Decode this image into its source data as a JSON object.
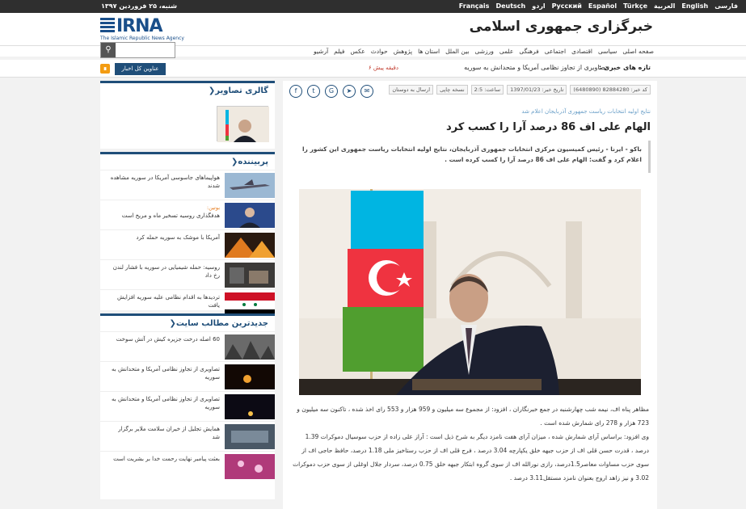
{
  "topbar": {
    "date": "شنبه، ۲۵ فروردین ۱۳۹۷",
    "languages": [
      "فارسی",
      "English",
      "العربية",
      "Türkçe",
      "Español",
      "Русский",
      "اردو",
      "Deutsch",
      "Français"
    ]
  },
  "header": {
    "logo_word": "IRNA",
    "logo_tag": "The Islamic Republic News Agency",
    "site_title": "خبرگزاری جمهوری اسلامی"
  },
  "nav": [
    "صفحه اصلی",
    "سیاسی",
    "اقتصادی",
    "اجتماعی",
    "فرهنگی",
    "علمی",
    "ورزشی",
    "بین الملل",
    "استان ها",
    "پژوهش",
    "حوادث",
    "عکس",
    "فیلم",
    "آرشیو"
  ],
  "search": {
    "placeholder": "",
    "icon": "search-icon"
  },
  "ticker": {
    "label": "تازه های خبری :",
    "headline": "تصاویری از تجاوز نظامی آمریکا و متحدانش به سوریه",
    "ago": "۶ دقیقه پیش"
  },
  "all_news_button": "عناوین کل اخبار",
  "sidebar": {
    "gallery_title": "گالری تصاویر",
    "popular_title": "پربیننده",
    "popular": [
      {
        "text": "هواپیماهای جاسوسی آمریکا در سوریه مشاهده شدند",
        "tag": ""
      },
      {
        "text": "هدفگذاری روسیه تسخیر ماه و مریخ است",
        "tag": "بوتین:"
      },
      {
        "text": "آمریکا با موشک به سوریه حمله کرد",
        "tag": ""
      },
      {
        "text": "روسیه: حمله شیمیایی در سوریه با فشار لندن رخ داد",
        "tag": ""
      },
      {
        "text": "تردیدها به اقدام نظامی علیه سوریه افزایش یافت",
        "tag": ""
      }
    ],
    "latest_title": "جدیدترین مطالب سایت",
    "latest": [
      {
        "text": "60 اصله درخت جزیره کیش در آتش سوخت"
      },
      {
        "text": "تصاویری از تجاوز نظامی آمریکا و متحدانش به سوریه"
      },
      {
        "text": "تصاویری از تجاوز نظامی آمریکا و متحدانش به سوریه"
      },
      {
        "text": "همایش تجلیل از خیران سلامت ملایر برگزار شد"
      },
      {
        "text": "بعثت پیامبر نهایت رحمت خدا بر بشریت است"
      }
    ]
  },
  "article": {
    "meta": [
      "کد خبر: 82884280 (6480890)",
      "تاریخ خبر: 1397/01/23",
      "ساعت: 2:5",
      "نسخه چاپی",
      "ارسال به دوستان"
    ],
    "kicker": "نتایج اولیه انتخابات ریاست جمهوری آذربایجان اعلام شد",
    "headline": "الهام علی اف 86 درصد آرا را کسب کرد",
    "lead": "باکو - ایرنا - رئیس کمیسیون مرکزی انتخابات جمهوری آذربایجان، نتایج اولیه انتخابات ریاست جمهوری این کشور را اعلام کرد و گفت: الهام علی اف 86 درصد آرا را کسب کرده است .",
    "body": [
      "مظاهر پناه اف، نیمه شب چهارشنبه در جمع خبرنگاران ، افزود: از مجموع سه میلیون و 959 هزار و 553 رای اخذ شده ، تاکنون سه میلیون و 723 هزار و 278 رای شمارش شده است .",
      "وی افزود: براساس آرای شمارش شده ، میزان آرای هفت نامزد دیگر به شرح ذیل است : آراز علی زاده از حزب سوسیال دموکرات 1.39 درصد ، قدرت حسن قلی اف از حزب جبهه خلق یکپارچه 3.04 درصد ، فرج قلی اف از حزب رستاخیز ملی 1.18 درصد، حافظ حاجی اف از سوی حزب مساوات معاصر1.5درصد، رازی نورالله اف از سوی گروه ابتکار جبهه خلق 0.75 درصد، سردار جلال اوغلی از سوی حزب دموکرات 3.02 و نیز زاهد اروج بعنوان نامزد مستقل3.11 درصد ."
    ]
  }
}
